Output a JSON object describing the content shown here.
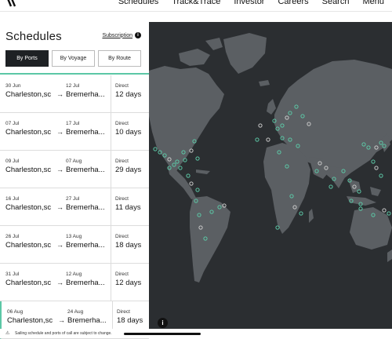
{
  "nav": {
    "links": [
      "Schedules",
      "Track&Trace",
      "Investor",
      "Careers",
      "Search",
      "Menu"
    ]
  },
  "panel": {
    "title": "Schedules",
    "subscription": "Subscription",
    "tabs": [
      "By Ports",
      "By Voyage",
      "By Route"
    ],
    "active_tab": "By Ports",
    "progress": 1.0
  },
  "schedules": [
    {
      "dep_date": "30 Jun",
      "origin": "Charleston,sc",
      "arr_date": "12 Jul",
      "destination": "Bremerha...",
      "type": "Direct",
      "duration": "12 days"
    },
    {
      "dep_date": "07 Jul",
      "origin": "Charleston,sc",
      "arr_date": "17 Jul",
      "destination": "Bremerha...",
      "type": "Direct",
      "duration": "10 days"
    },
    {
      "dep_date": "09 Jul",
      "origin": "Charleston,sc",
      "arr_date": "07 Aug",
      "destination": "Bremerha...",
      "type": "Direct",
      "duration": "29 days"
    },
    {
      "dep_date": "16 Jul",
      "origin": "Charleston,sc",
      "arr_date": "27 Jul",
      "destination": "Bremerha...",
      "type": "Direct",
      "duration": "11 days"
    },
    {
      "dep_date": "26 Jul",
      "origin": "Charleston,sc",
      "arr_date": "13 Aug",
      "destination": "Bremerha...",
      "type": "Direct",
      "duration": "18 days"
    },
    {
      "dep_date": "31 Jul",
      "origin": "Charleston,sc",
      "arr_date": "12 Aug",
      "destination": "Bremerha...",
      "type": "Direct",
      "duration": "12 days"
    },
    {
      "dep_date": "06 Aug",
      "origin": "Charleston,sc",
      "arr_date": "24 Aug",
      "destination": "Bremerha...",
      "type": "Direct",
      "duration": "18 days"
    }
  ],
  "footer": {
    "notice": "Sailing schedule and ports of call are subject to change."
  },
  "colors": {
    "accent": "#5cc7a6",
    "map_ocean": "#2b2e31",
    "map_land": "#5b5f63",
    "dark_button": "#1e2124"
  }
}
